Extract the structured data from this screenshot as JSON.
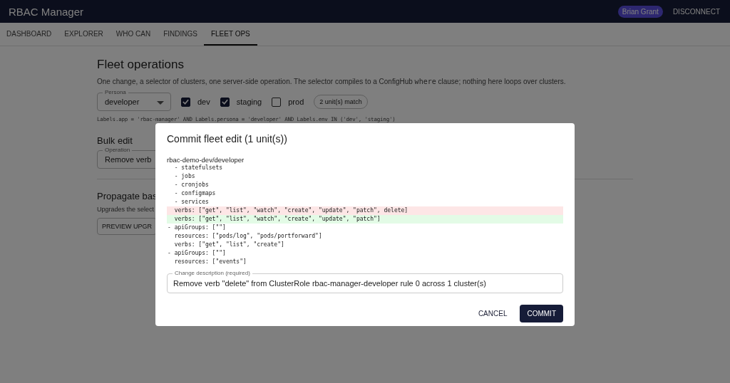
{
  "app_bar": {
    "title": "RBAC Manager",
    "user": "Brian Grant",
    "action": "DISCONNECT"
  },
  "tabs": [
    {
      "label": "DASHBOARD",
      "selected": false
    },
    {
      "label": "EXPLORER",
      "selected": false
    },
    {
      "label": "WHO CAN",
      "selected": false
    },
    {
      "label": "FINDINGS",
      "selected": false
    },
    {
      "label": "FLEET OPS",
      "selected": true
    }
  ],
  "page": {
    "title": "Fleet operations",
    "description": "One change, a selector of clusters, one server-side operation. The selector compiles to a ConfigHub **where** clause; nothing here loops over clusters.",
    "persona": {
      "label": "Persona",
      "value": "developer"
    },
    "envs": [
      {
        "label": "dev",
        "checked": true
      },
      {
        "label": "staging",
        "checked": true
      },
      {
        "label": "prod",
        "checked": false
      }
    ],
    "match_chip": "2 unit(s) match",
    "where_clause": "Labels.app = 'rbac-manager' AND Labels.persona = 'developer' AND Labels.env IN ('dev', 'staging')",
    "bulk_edit": {
      "title": "Bulk edit",
      "operation": {
        "label": "Operation",
        "value": "Remove verb"
      }
    },
    "propagate": {
      "title": "Propagate bas",
      "description": "Upgrades the select",
      "button": "PREVIEW UPGR"
    }
  },
  "dialog": {
    "title": "Commit fleet edit (1 unit(s))",
    "unit": "rbac-demo-dev/developer",
    "diff": [
      {
        "kind": "context",
        "text": "  - statefulsets"
      },
      {
        "kind": "context",
        "text": "  - jobs"
      },
      {
        "kind": "context",
        "text": "  - cronjobs"
      },
      {
        "kind": "context",
        "text": "  - configmaps"
      },
      {
        "kind": "context",
        "text": "  - services"
      },
      {
        "kind": "removed",
        "text": "  verbs: [\"get\", \"list\", \"watch\", \"create\", \"update\", \"patch\", delete]"
      },
      {
        "kind": "added",
        "text": "  verbs: [\"get\", \"list\", \"watch\", \"create\", \"update\", \"patch\"]"
      },
      {
        "kind": "context",
        "text": "- apiGroups: [\"\"]"
      },
      {
        "kind": "context",
        "text": "  resources: [\"pods/log\", \"pods/portforward\"]"
      },
      {
        "kind": "context",
        "text": "  verbs: [\"get\", \"list\", \"create\"]"
      },
      {
        "kind": "context",
        "text": "- apiGroups: [\"\"]"
      },
      {
        "kind": "context",
        "text": "  resources: [\"events\"]"
      }
    ],
    "description": {
      "label": "Change description (required)",
      "value": "Remove verb \"delete\" from ClusterRole rbac-manager-developer rule 0 across 1 cluster(s)"
    },
    "buttons": [
      {
        "kind": "text",
        "label": "CANCEL"
      },
      {
        "kind": "primary",
        "label": "COMMIT"
      }
    ]
  }
}
